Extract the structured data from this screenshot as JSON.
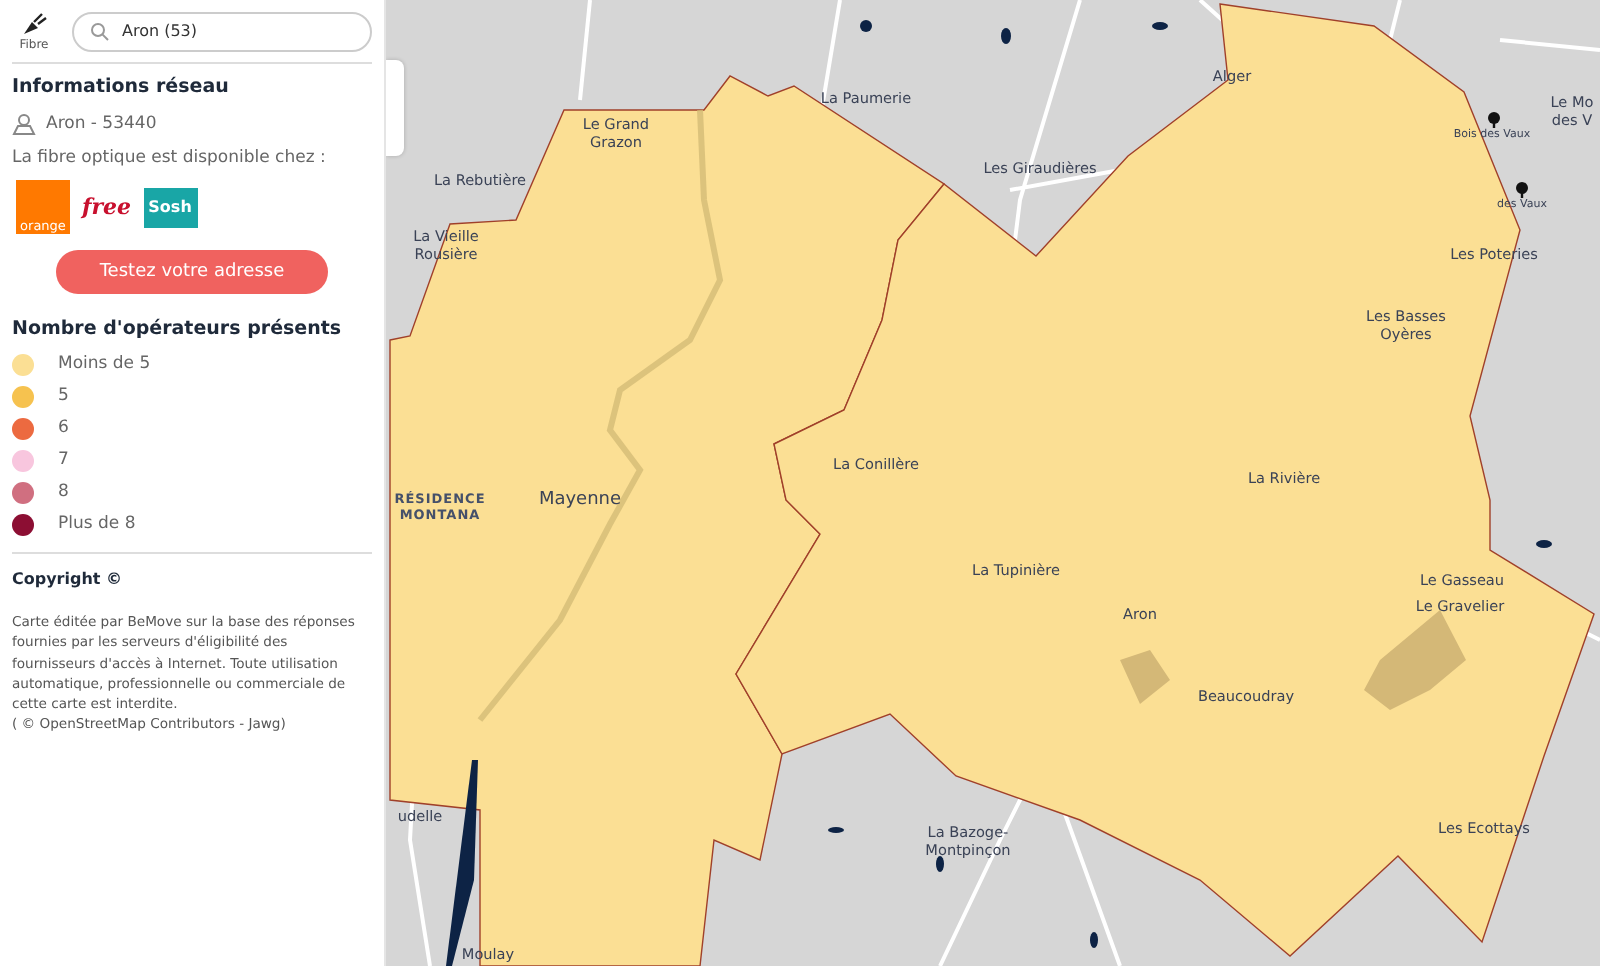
{
  "app": {
    "logo_label": "Fibre"
  },
  "search": {
    "value": "Aron (53)"
  },
  "network": {
    "title": "Informations réseau",
    "place": "Aron - 53440",
    "availability": "La fibre optique est disponible chez :",
    "operators": [
      {
        "kind": "orange",
        "name": "orange"
      },
      {
        "kind": "free",
        "name": "free"
      },
      {
        "kind": "sosh",
        "name": "Sosh"
      }
    ],
    "button": "Testez votre adresse"
  },
  "legend": {
    "title": "Nombre d'opérateurs présents",
    "items": [
      {
        "label": "Moins de 5",
        "color": "#fbdf94"
      },
      {
        "label": "5",
        "color": "#f6c24f"
      },
      {
        "label": "6",
        "color": "#ec6a40"
      },
      {
        "label": "7",
        "color": "#f8c6de"
      },
      {
        "label": "8",
        "color": "#d06f80"
      },
      {
        "label": "Plus de 8",
        "color": "#8c0e33"
      }
    ]
  },
  "copyright": {
    "title": "Copyright ©",
    "text": "Carte éditée par BeMove sur la base des réponses fournies par les serveurs d'éligibilité des fournisseurs d'accès à Internet. Toute utilisation automatique, professionnelle ou commerciale de cette carte est interdite.",
    "attribution": "( © OpenStreetMap Contributors - Jawg)"
  },
  "map": {
    "labels": [
      {
        "text": "Le Grand Grazon",
        "kind": "place"
      },
      {
        "text": "La Rebutière",
        "kind": "place"
      },
      {
        "text": "La Vieille Rousière",
        "kind": "place"
      },
      {
        "text": "La Paumerie",
        "kind": "place"
      },
      {
        "text": "Les Giraudières",
        "kind": "place"
      },
      {
        "text": "Alger",
        "kind": "place"
      },
      {
        "text": "Bois des Vaux",
        "kind": "poi"
      },
      {
        "text": "des Vaux",
        "kind": "poi"
      },
      {
        "text": "Le Mo des V",
        "kind": "place"
      },
      {
        "text": "Les Poteries",
        "kind": "place"
      },
      {
        "text": "Les Basses Oyères",
        "kind": "place"
      },
      {
        "text": "La Conillère",
        "kind": "place"
      },
      {
        "text": "La Rivière",
        "kind": "place"
      },
      {
        "text": "RÉSIDENCE MONTANA",
        "kind": "district"
      },
      {
        "text": "Mayenne",
        "kind": "town"
      },
      {
        "text": "La Tupinière",
        "kind": "place"
      },
      {
        "text": "Aron",
        "kind": "place"
      },
      {
        "text": "Le Gasseau",
        "kind": "place"
      },
      {
        "text": "Le Gravelier",
        "kind": "place"
      },
      {
        "text": "Beaucoudray",
        "kind": "place"
      },
      {
        "text": "Les Ecottays",
        "kind": "place"
      },
      {
        "text": "La Bazoge-Montpinçon",
        "kind": "place"
      },
      {
        "text": "udelle",
        "kind": "place"
      },
      {
        "text": "Moulay",
        "kind": "place"
      }
    ]
  }
}
